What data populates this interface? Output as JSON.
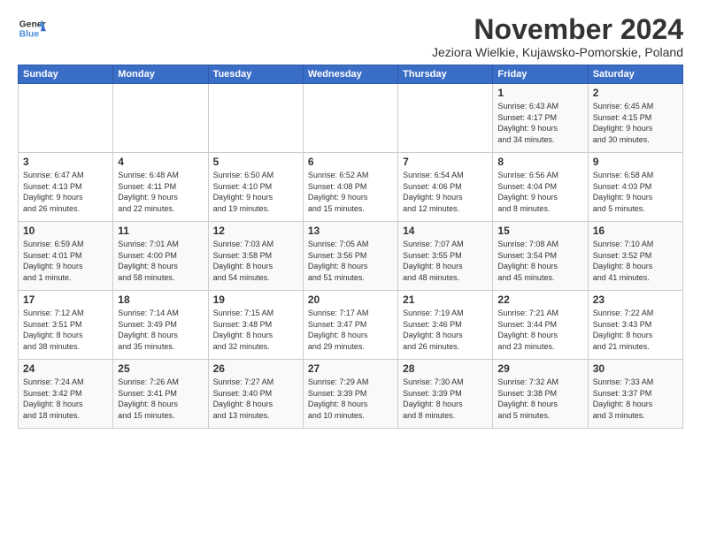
{
  "logo": {
    "line1": "General",
    "line2": "Blue"
  },
  "title": "November 2024",
  "location": "Jeziora Wielkie, Kujawsko-Pomorskie, Poland",
  "headers": [
    "Sunday",
    "Monday",
    "Tuesday",
    "Wednesday",
    "Thursday",
    "Friday",
    "Saturday"
  ],
  "weeks": [
    [
      {
        "day": "",
        "info": ""
      },
      {
        "day": "",
        "info": ""
      },
      {
        "day": "",
        "info": ""
      },
      {
        "day": "",
        "info": ""
      },
      {
        "day": "",
        "info": ""
      },
      {
        "day": "1",
        "info": "Sunrise: 6:43 AM\nSunset: 4:17 PM\nDaylight: 9 hours\nand 34 minutes."
      },
      {
        "day": "2",
        "info": "Sunrise: 6:45 AM\nSunset: 4:15 PM\nDaylight: 9 hours\nand 30 minutes."
      }
    ],
    [
      {
        "day": "3",
        "info": "Sunrise: 6:47 AM\nSunset: 4:13 PM\nDaylight: 9 hours\nand 26 minutes."
      },
      {
        "day": "4",
        "info": "Sunrise: 6:48 AM\nSunset: 4:11 PM\nDaylight: 9 hours\nand 22 minutes."
      },
      {
        "day": "5",
        "info": "Sunrise: 6:50 AM\nSunset: 4:10 PM\nDaylight: 9 hours\nand 19 minutes."
      },
      {
        "day": "6",
        "info": "Sunrise: 6:52 AM\nSunset: 4:08 PM\nDaylight: 9 hours\nand 15 minutes."
      },
      {
        "day": "7",
        "info": "Sunrise: 6:54 AM\nSunset: 4:06 PM\nDaylight: 9 hours\nand 12 minutes."
      },
      {
        "day": "8",
        "info": "Sunrise: 6:56 AM\nSunset: 4:04 PM\nDaylight: 9 hours\nand 8 minutes."
      },
      {
        "day": "9",
        "info": "Sunrise: 6:58 AM\nSunset: 4:03 PM\nDaylight: 9 hours\nand 5 minutes."
      }
    ],
    [
      {
        "day": "10",
        "info": "Sunrise: 6:59 AM\nSunset: 4:01 PM\nDaylight: 9 hours\nand 1 minute."
      },
      {
        "day": "11",
        "info": "Sunrise: 7:01 AM\nSunset: 4:00 PM\nDaylight: 8 hours\nand 58 minutes."
      },
      {
        "day": "12",
        "info": "Sunrise: 7:03 AM\nSunset: 3:58 PM\nDaylight: 8 hours\nand 54 minutes."
      },
      {
        "day": "13",
        "info": "Sunrise: 7:05 AM\nSunset: 3:56 PM\nDaylight: 8 hours\nand 51 minutes."
      },
      {
        "day": "14",
        "info": "Sunrise: 7:07 AM\nSunset: 3:55 PM\nDaylight: 8 hours\nand 48 minutes."
      },
      {
        "day": "15",
        "info": "Sunrise: 7:08 AM\nSunset: 3:54 PM\nDaylight: 8 hours\nand 45 minutes."
      },
      {
        "day": "16",
        "info": "Sunrise: 7:10 AM\nSunset: 3:52 PM\nDaylight: 8 hours\nand 41 minutes."
      }
    ],
    [
      {
        "day": "17",
        "info": "Sunrise: 7:12 AM\nSunset: 3:51 PM\nDaylight: 8 hours\nand 38 minutes."
      },
      {
        "day": "18",
        "info": "Sunrise: 7:14 AM\nSunset: 3:49 PM\nDaylight: 8 hours\nand 35 minutes."
      },
      {
        "day": "19",
        "info": "Sunrise: 7:15 AM\nSunset: 3:48 PM\nDaylight: 8 hours\nand 32 minutes."
      },
      {
        "day": "20",
        "info": "Sunrise: 7:17 AM\nSunset: 3:47 PM\nDaylight: 8 hours\nand 29 minutes."
      },
      {
        "day": "21",
        "info": "Sunrise: 7:19 AM\nSunset: 3:46 PM\nDaylight: 8 hours\nand 26 minutes."
      },
      {
        "day": "22",
        "info": "Sunrise: 7:21 AM\nSunset: 3:44 PM\nDaylight: 8 hours\nand 23 minutes."
      },
      {
        "day": "23",
        "info": "Sunrise: 7:22 AM\nSunset: 3:43 PM\nDaylight: 8 hours\nand 21 minutes."
      }
    ],
    [
      {
        "day": "24",
        "info": "Sunrise: 7:24 AM\nSunset: 3:42 PM\nDaylight: 8 hours\nand 18 minutes."
      },
      {
        "day": "25",
        "info": "Sunrise: 7:26 AM\nSunset: 3:41 PM\nDaylight: 8 hours\nand 15 minutes."
      },
      {
        "day": "26",
        "info": "Sunrise: 7:27 AM\nSunset: 3:40 PM\nDaylight: 8 hours\nand 13 minutes."
      },
      {
        "day": "27",
        "info": "Sunrise: 7:29 AM\nSunset: 3:39 PM\nDaylight: 8 hours\nand 10 minutes."
      },
      {
        "day": "28",
        "info": "Sunrise: 7:30 AM\nSunset: 3:39 PM\nDaylight: 8 hours\nand 8 minutes."
      },
      {
        "day": "29",
        "info": "Sunrise: 7:32 AM\nSunset: 3:38 PM\nDaylight: 8 hours\nand 5 minutes."
      },
      {
        "day": "30",
        "info": "Sunrise: 7:33 AM\nSunset: 3:37 PM\nDaylight: 8 hours\nand 3 minutes."
      }
    ]
  ]
}
